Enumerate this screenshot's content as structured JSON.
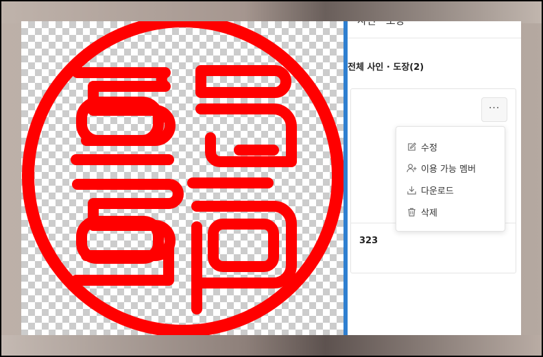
{
  "panel": {
    "header_title": "사인 · 도장",
    "section_title": "전체 사인 · 도장(2)"
  },
  "card": {
    "more_label": "···",
    "name": "323"
  },
  "menu": {
    "items": [
      {
        "label": "수정",
        "icon": "edit-icon"
      },
      {
        "label": "이용 가능 멤버",
        "icon": "add-user-icon"
      },
      {
        "label": "다운로드",
        "icon": "download-icon"
      },
      {
        "label": "삭제",
        "icon": "trash-icon"
      }
    ]
  },
  "stamp": {
    "color": "#ff0000",
    "text": "윤철"
  },
  "colors": {
    "divider": "#2f7fd0",
    "checker": "#cccccc"
  }
}
